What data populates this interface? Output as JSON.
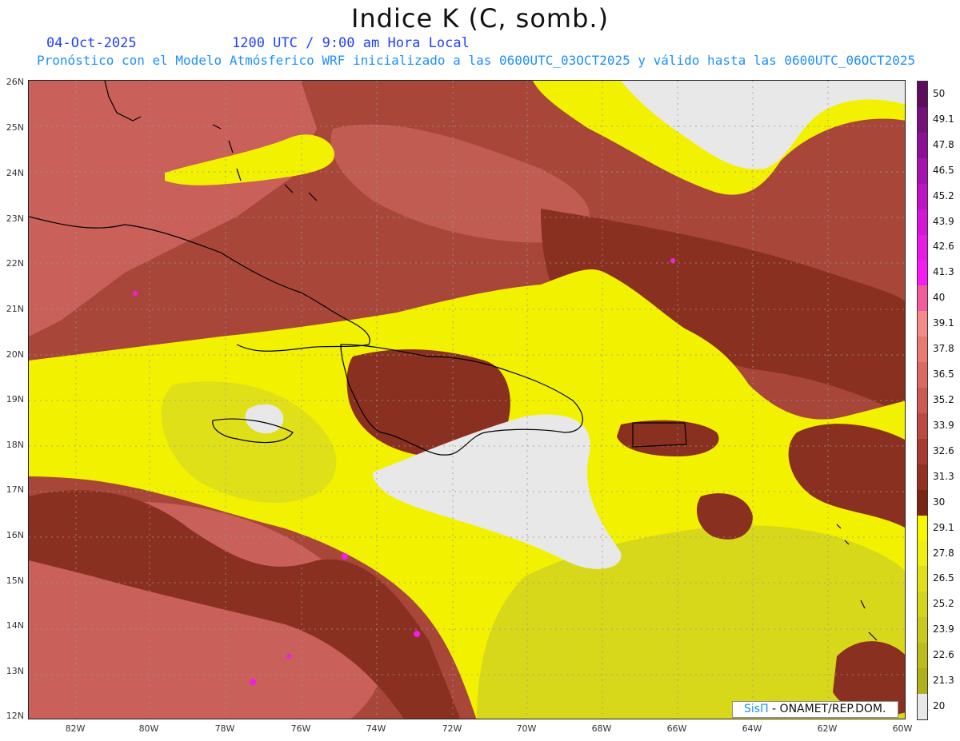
{
  "header": {
    "title": "Indice K (C, somb.)",
    "date": "04-Oct-2025",
    "valid_time": "1200 UTC / 9:00 am Hora Local",
    "description": "Pronóstico con el Modelo Atmósferico WRF inicializado a las 0600UTC_03OCT2025 y válido hasta las  0600UTC_06OCT2025"
  },
  "axes": {
    "lat_labels": [
      "26N",
      "25N",
      "24N",
      "23N",
      "22N",
      "21N",
      "20N",
      "19N",
      "18N",
      "17N",
      "16N",
      "15N",
      "14N",
      "13N",
      "12N"
    ],
    "lon_labels": [
      "82W",
      "80W",
      "78W",
      "76W",
      "74W",
      "72W",
      "70W",
      "68W",
      "66W",
      "64W",
      "62W",
      "60W"
    ]
  },
  "colorbar": {
    "labels": [
      "50",
      "49.1",
      "47.8",
      "46.5",
      "45.2",
      "43.9",
      "42.6",
      "41.3",
      "40",
      "39.1",
      "37.8",
      "36.5",
      "35.2",
      "33.9",
      "32.6",
      "31.3",
      "30",
      "29.1",
      "27.8",
      "26.5",
      "25.2",
      "23.9",
      "22.6",
      "21.3",
      "20"
    ],
    "colors": [
      "#5e0a5e",
      "#76107a",
      "#8e0f96",
      "#a512b0",
      "#bf14c6",
      "#d516d8",
      "#e818e6",
      "#f81cf4",
      "#f25c9a",
      "#f48a8a",
      "#e87a72",
      "#dc6a60",
      "#cd5a50",
      "#bd4a40",
      "#a83a2e",
      "#93301f",
      "#7a2612",
      "#f6f600",
      "#eeee10",
      "#e0e018",
      "#d4d41c",
      "#c8c81e",
      "#bcbc1c",
      "#b0b01a",
      "#e8e8e8"
    ]
  },
  "map": {
    "colors": {
      "low": "#e8e8e8",
      "k25": "#d8d81a",
      "k28": "#f2f200",
      "k31": "#8a3020",
      "k34": "#a8463a",
      "k37": "#c9605a",
      "k40": "#f21cf0"
    }
  },
  "credit": {
    "brand": "SisΠ",
    "text": " - ONAMET/REP.DOM."
  }
}
